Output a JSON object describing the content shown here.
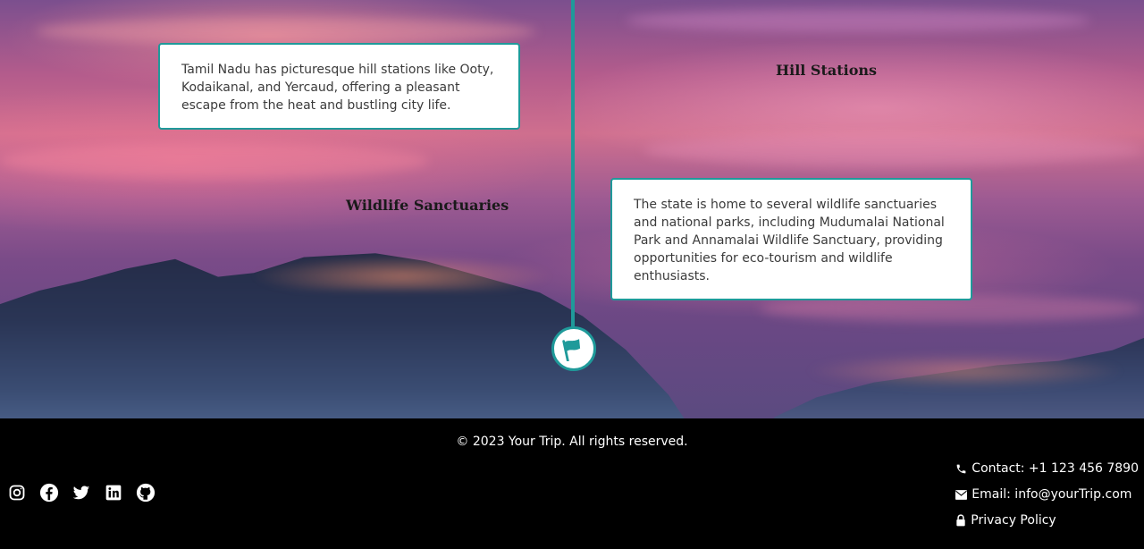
{
  "timeline": {
    "items": [
      {
        "heading": "Hill Stations",
        "text": "Tamil Nadu has picturesque hill stations like Ooty, Kodaikanal, and Yercaud, offering a pleasant escape from the heat and bustling city life."
      },
      {
        "heading": "Wildlife Sanctuaries",
        "text": "The state is home to several wildlife sanctuaries and national parks, including Mudumalai National Park and Annamalai Wildlife Sanctuary, providing opportunities for eco-tourism and wildlife enthusiasts."
      }
    ],
    "accent_color": "#1f9a9a",
    "marker_icon": "flag-icon"
  },
  "footer": {
    "copyright": "© 2023 Your Trip. All rights reserved.",
    "social": [
      "instagram-icon",
      "facebook-icon",
      "twitter-icon",
      "linkedin-icon",
      "github-icon"
    ],
    "contact": "Contact: +1 123 456 7890",
    "email": "Email: info@yourTrip.com",
    "privacy": "Privacy Policy"
  }
}
